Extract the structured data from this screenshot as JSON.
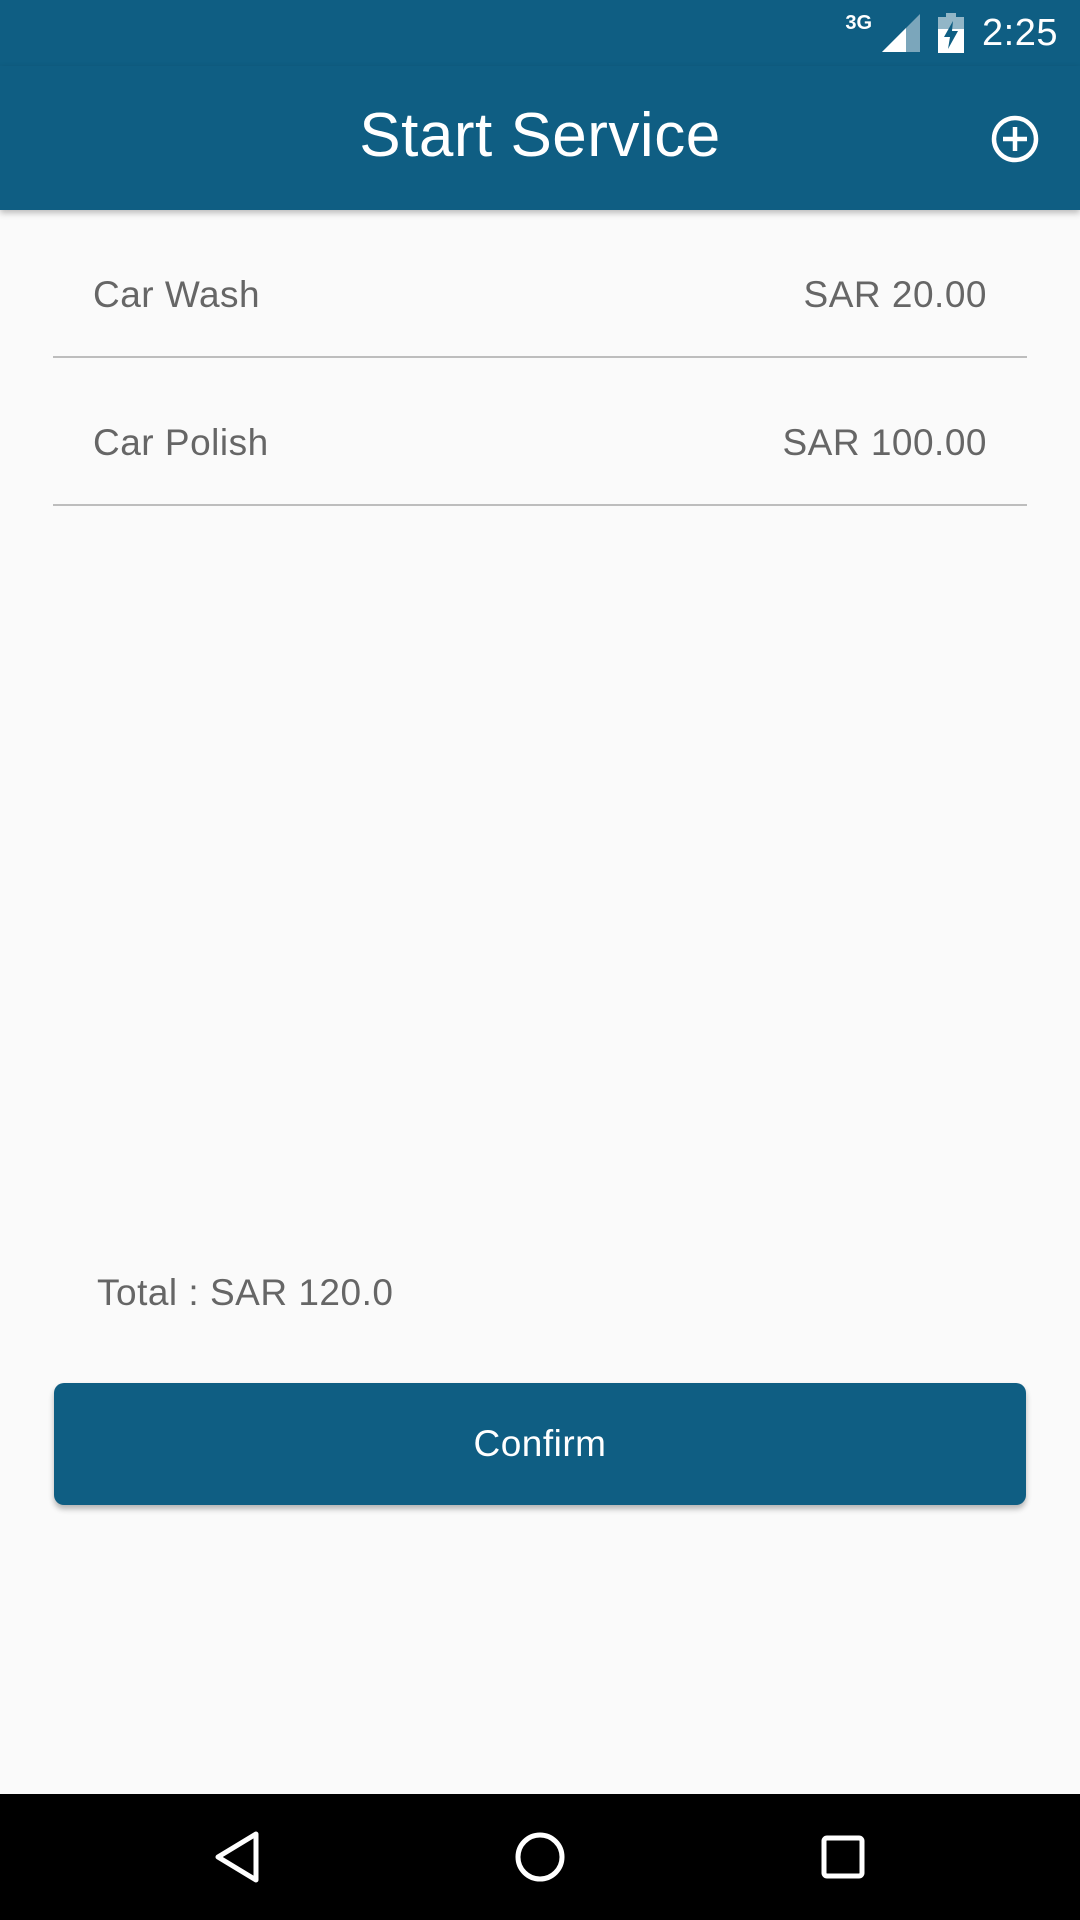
{
  "status_bar": {
    "network_label": "3G",
    "time": "2:25",
    "icons": [
      "signal-icon",
      "battery-charging-icon"
    ]
  },
  "app_bar": {
    "title": "Start Service",
    "action_icon": "add-circle-icon"
  },
  "services": [
    {
      "name": "Car Wash",
      "price": "SAR 20.00"
    },
    {
      "name": "Car Polish",
      "price": "SAR 100.00"
    }
  ],
  "total": "Total : SAR 120.0",
  "confirm_label": "Confirm",
  "nav_bar": {
    "icons": [
      "back-icon",
      "home-icon",
      "recent-apps-icon"
    ]
  },
  "colors": {
    "primary": "#0f5e83",
    "background": "#fafafa",
    "text_secondary": "#666666",
    "divider": "#bdbdbd"
  }
}
